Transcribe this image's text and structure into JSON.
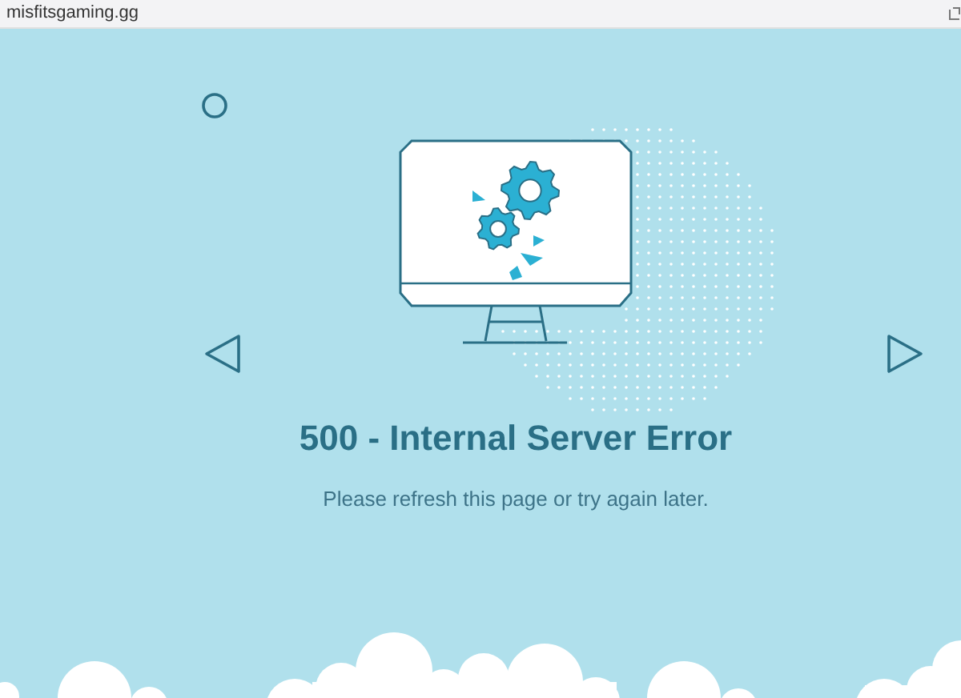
{
  "address_bar": {
    "url": "misfitsgaming.gg"
  },
  "error": {
    "title": "500 - Internal Server Error",
    "message": "Please refresh this page or try again later."
  }
}
